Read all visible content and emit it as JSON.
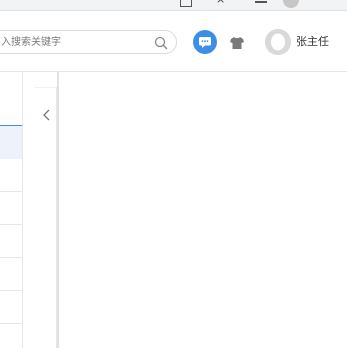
{
  "header": {
    "search": {
      "placeholder": "入搜索关键字",
      "value": ""
    },
    "user": {
      "name": "张主任"
    },
    "icons": {
      "search": "search-icon",
      "message": "message-icon",
      "theme": "shirt-icon",
      "avatar": "avatar-icon"
    }
  },
  "panels": {
    "collapse_icon": "chevron-left-icon"
  },
  "colors": {
    "accent": "#3d8fe6",
    "border": "#e6e6e6",
    "avatar_bg": "#d9d9d9"
  }
}
